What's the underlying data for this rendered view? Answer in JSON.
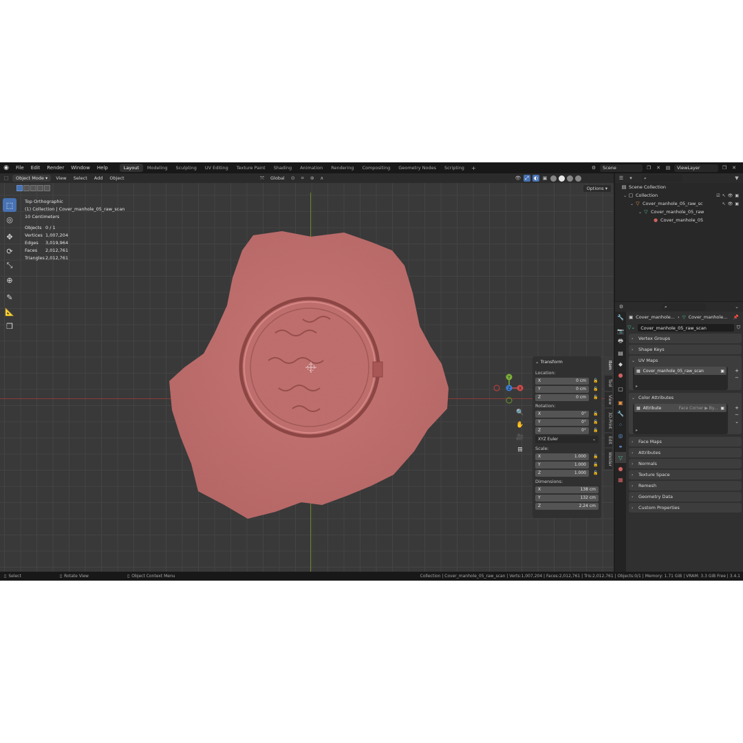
{
  "menu": [
    "File",
    "Edit",
    "Render",
    "Window",
    "Help"
  ],
  "workspaces": [
    "Layout",
    "Modeling",
    "Sculpting",
    "UV Editing",
    "Texture Paint",
    "Shading",
    "Animation",
    "Rendering",
    "Compositing",
    "Geometry Nodes",
    "Scripting"
  ],
  "active_workspace": "Layout",
  "scene": {
    "name": "Scene",
    "view_layer": "ViewLayer"
  },
  "viewport": {
    "mode": "Object Mode",
    "header_menu": [
      "View",
      "Select",
      "Add",
      "Object"
    ],
    "orientation": "Global",
    "options_label": "Options",
    "view_name": "Top Orthographic",
    "collection_line": "(1) Collection | Cover_manhole_05_raw_scan",
    "grid_scale": "10 Centimeters",
    "stats": [
      {
        "label": "Objects",
        "value": "0 / 1"
      },
      {
        "label": "Vertices",
        "value": "1,007,204"
      },
      {
        "label": "Edges",
        "value": "3,019,964"
      },
      {
        "label": "Faces",
        "value": "2,012,761"
      },
      {
        "label": "Triangles",
        "value": "2,012,761"
      }
    ],
    "gizmo": {
      "x": "X",
      "y": "Y",
      "z": "Z"
    }
  },
  "transform": {
    "title": "Transform",
    "location_label": "Location:",
    "location": [
      {
        "axis": "X",
        "value": "0 cm"
      },
      {
        "axis": "Y",
        "value": "0 cm"
      },
      {
        "axis": "Z",
        "value": "0 cm"
      }
    ],
    "rotation_label": "Rotation:",
    "rotation": [
      {
        "axis": "X",
        "value": "0°"
      },
      {
        "axis": "Y",
        "value": "0°"
      },
      {
        "axis": "Z",
        "value": "0°"
      }
    ],
    "rotation_mode": "XYZ Euler",
    "scale_label": "Scale:",
    "scale": [
      {
        "axis": "X",
        "value": "1.000"
      },
      {
        "axis": "Y",
        "value": "1.000"
      },
      {
        "axis": "Z",
        "value": "1.000"
      }
    ],
    "dimensions_label": "Dimensions:",
    "dimensions": [
      {
        "axis": "X",
        "value": "138 cm"
      },
      {
        "axis": "Y",
        "value": "132 cm"
      },
      {
        "axis": "Z",
        "value": "2.24 cm"
      }
    ]
  },
  "side_tabs": [
    "Item",
    "Tool",
    "View",
    "3D-Print",
    "Edit",
    "Welder"
  ],
  "outliner": {
    "rows": [
      "Scene Collection",
      "Collection",
      "Cover_manhole_05_raw_sc",
      "Cover_manhole_05_raw",
      "Cover_manhole_05"
    ]
  },
  "properties": {
    "path_object": "Cover_manhole...",
    "path_mesh": "Cover_manhole...",
    "mesh_name": "Cover_manhole_05_raw_scan",
    "panels_top": [
      "Vertex Groups",
      "Shape Keys"
    ],
    "uv_maps_title": "UV Maps",
    "uv_map_item": "Cover_manhole_05_raw_scan",
    "color_attr_title": "Color Attributes",
    "color_attr_item": "Attribute",
    "color_attr_domain": "Face Corner ▶ By...",
    "panels_bottom": [
      "Face Maps",
      "Attributes",
      "Normals",
      "Texture Space",
      "Remesh",
      "Geometry Data",
      "Custom Properties"
    ]
  },
  "status": {
    "select": "Select",
    "rotate": "Rotate View",
    "context": "Object Context Menu",
    "info": "Collection | Cover_manhole_05_raw_scan | Verts:1,007,204 | Faces:2,012,761 | Tris:2,012,761 | Objects:0/1 | Memory: 1.71 GiB | VRAM: 3.3 GiB Free | 3.4.1"
  },
  "colors": {
    "accent": "#4772b3",
    "mesh": "#c46a68",
    "mesh_dark": "#9b4e4d"
  }
}
